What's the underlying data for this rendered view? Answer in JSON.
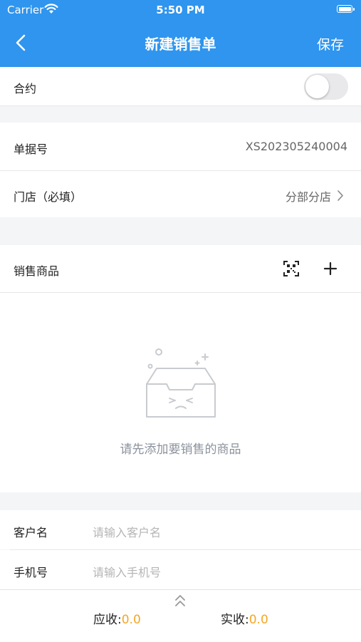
{
  "status_bar": {
    "carrier": "Carrier",
    "time": "5:50 PM"
  },
  "nav": {
    "title": "新建销售单",
    "save_label": "保存"
  },
  "contract": {
    "label": "合约",
    "enabled": false
  },
  "doc_number": {
    "label": "单据号",
    "value": "XS202305240004"
  },
  "store": {
    "label": "门店（必填）",
    "value": "分部分店"
  },
  "products": {
    "label": "销售商品",
    "empty_text": "请先添加要销售的商品"
  },
  "customer": {
    "name_label": "客户名",
    "name_placeholder": "请输入客户名",
    "phone_label": "手机号",
    "phone_placeholder": "请输入手机号"
  },
  "footer": {
    "receivable_label": "应收:",
    "receivable": "0.0",
    "received_label": "实收:",
    "received": "0.0"
  },
  "colors": {
    "primary": "#2f95ee",
    "amount": "#f5a623"
  }
}
